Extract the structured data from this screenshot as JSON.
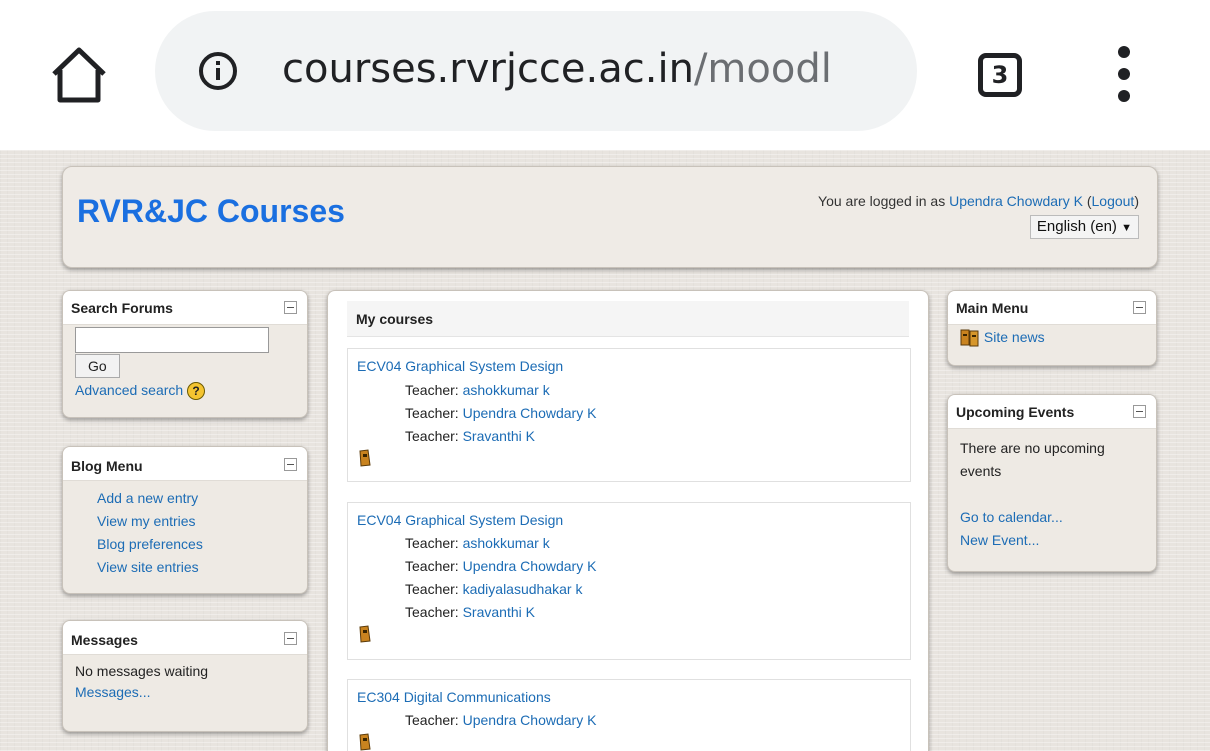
{
  "browser": {
    "url_host": "courses.rvrjcce.ac.in",
    "url_path": "/moodl",
    "tab_count": "3",
    "icons": [
      "home-icon",
      "info-icon",
      "tabs-icon",
      "overflow-menu-icon"
    ]
  },
  "header": {
    "site_title": "RVR&JC Courses",
    "login_prefix": "You are logged in as ",
    "user_name": "Upendra Chowdary K",
    "logout_open": " (",
    "logout_label": "Logout",
    "logout_close": ")",
    "language": "English (en)",
    "language_arrow": "▼"
  },
  "search_block": {
    "title": "Search Forums",
    "go_label": "Go",
    "advanced_label": "Advanced search",
    "help_glyph": "?"
  },
  "blog_block": {
    "title": "Blog Menu",
    "items": [
      "Add a new entry",
      "View my entries",
      "Blog preferences",
      "View site entries"
    ]
  },
  "messages_block": {
    "title": "Messages",
    "status": "No messages waiting",
    "link": "Messages..."
  },
  "my_courses": {
    "title": "My courses",
    "courses": [
      {
        "name": "ECV04 Graphical System Design",
        "teachers": [
          "ashokkumar k",
          "Upendra Chowdary K",
          "Sravanthi K"
        ]
      },
      {
        "name": "ECV04 Graphical System Design",
        "teachers": [
          "ashokkumar k",
          "Upendra Chowdary K",
          "kadiyalasudhakar k",
          "Sravanthi K"
        ]
      },
      {
        "name": "EC304 Digital Communications",
        "teachers": [
          "Upendra Chowdary K"
        ]
      }
    ],
    "teacher_label": "Teacher: "
  },
  "main_menu_block": {
    "title": "Main Menu",
    "site_news": "Site news"
  },
  "events_block": {
    "title": "Upcoming Events",
    "status": "There are no upcoming events",
    "calendar_link": "Go to calendar...",
    "new_event_link": "New Event..."
  },
  "colors": {
    "link": "#1c6cb5",
    "site_title": "#1a6fe0",
    "page_bg": "#e8e4df"
  }
}
